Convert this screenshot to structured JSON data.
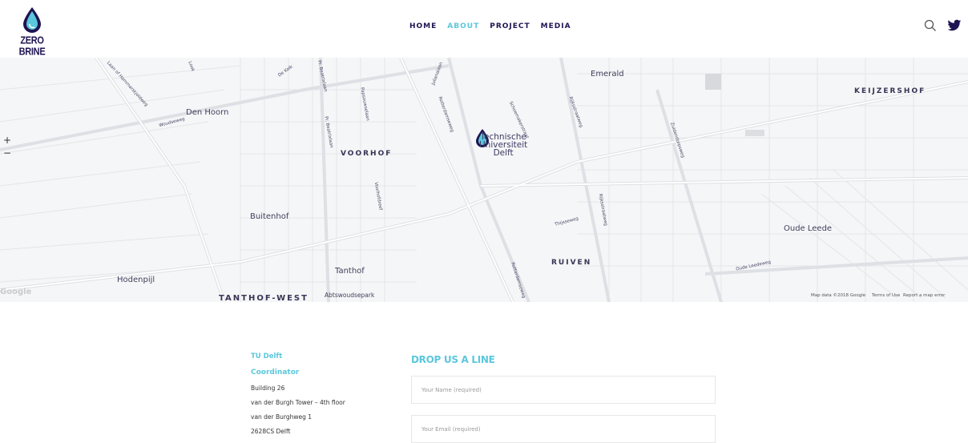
{
  "brand": {
    "name": "ZERO BRINE",
    "accent": "#5bc7dc",
    "dark": "#1e1452"
  },
  "nav": {
    "items": [
      {
        "label": "HOME",
        "active": false
      },
      {
        "label": "ABOUT",
        "active": true
      },
      {
        "label": "PROJECT",
        "active": false
      },
      {
        "label": "MEDIA",
        "active": false
      }
    ],
    "search_icon": "search-icon",
    "twitter_icon": "twitter-icon"
  },
  "map": {
    "districts": [
      "VOORHOF",
      "KEIJZERSHOF",
      "RUIVEN",
      "TANTHOF-WEST"
    ],
    "places": [
      "Den Hoorn",
      "Emerald",
      "Buitenhof",
      "Tanthof",
      "Hodenpijl",
      "Oude Leede",
      "Abtswoudsepark"
    ],
    "marker_label_1": "Technische",
    "marker_label_2": "Universiteit",
    "marker_label_3": "Delft",
    "streets": [
      "Laan of Hammarskjoldweg",
      "Woudseweg",
      "De Kolk",
      "Look",
      "Pr. Beatrixlaan",
      "Papsouwselaan",
      "Pr. Beatrixlaan",
      "Voorhofdreef",
      "Julianalaan",
      "Schoemakerstraat",
      "Rotterdamseweg",
      "Rijksstraatweg",
      "Rijksstraatweg",
      "Zuidendorpsweg",
      "Oude Leedeweg",
      "Thijsseweg",
      "Rotterdamseweg"
    ],
    "zoom_in": "+",
    "zoom_out": "−",
    "google": "Google",
    "footer_data": "Map data ©2018 Google",
    "footer_terms": "Terms of Use",
    "footer_report": "Report a map error"
  },
  "contact": {
    "org": "TU Delft",
    "role": "Coordinator",
    "lines": [
      "Building 26",
      "van der Burgh Tower – 4th floor",
      "van der Burghweg 1",
      "2628CS Delft"
    ]
  },
  "form": {
    "title": "DROP US A LINE",
    "name_placeholder": "Your Name (required)",
    "email_placeholder": "Your Email (required)"
  }
}
